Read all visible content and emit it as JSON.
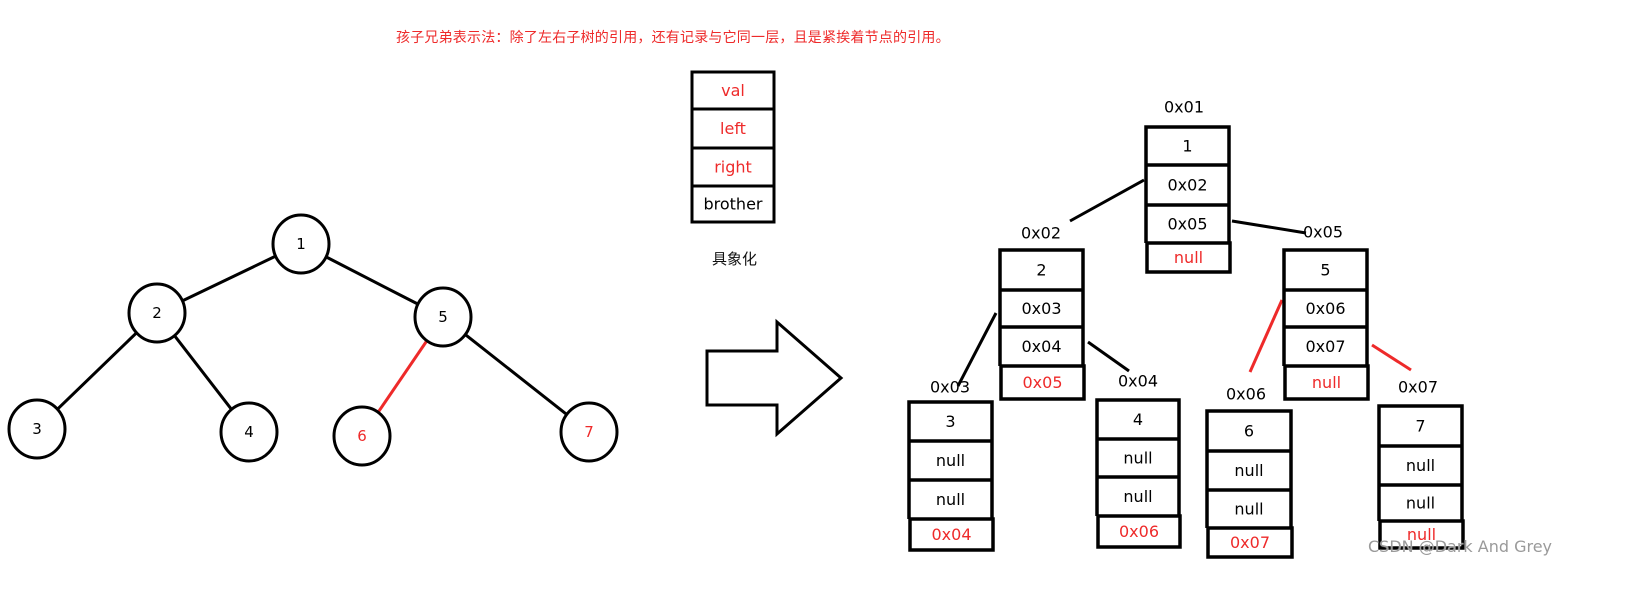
{
  "title": "孩子兄弟表示法：除了左右子树的引用，还有记录与它同一层，且是紧挨着节点的引用。",
  "concretize_label": "具象化",
  "watermark": "CSDN @Dark And Grey",
  "colors": {
    "accent_red": "#ee2a2a",
    "ink": "#000000",
    "watermark": "#9a9a9a"
  },
  "legend_node": {
    "fields": [
      {
        "label": "val",
        "color": "red"
      },
      {
        "label": "left",
        "color": "red"
      },
      {
        "label": "right",
        "color": "red"
      },
      {
        "label": "brother",
        "color": "black"
      }
    ]
  },
  "logical_tree": {
    "nodes": [
      {
        "id": "1",
        "label": "1",
        "color": "black"
      },
      {
        "id": "2",
        "label": "2",
        "color": "black"
      },
      {
        "id": "5",
        "label": "5",
        "color": "black"
      },
      {
        "id": "3",
        "label": "3",
        "color": "black"
      },
      {
        "id": "4",
        "label": "4",
        "color": "black"
      },
      {
        "id": "6",
        "label": "6",
        "color": "red"
      },
      {
        "id": "7",
        "label": "7",
        "color": "red"
      }
    ],
    "edges": [
      {
        "from": "1",
        "to": "2",
        "color": "black"
      },
      {
        "from": "1",
        "to": "5",
        "color": "black"
      },
      {
        "from": "2",
        "to": "3",
        "color": "black"
      },
      {
        "from": "2",
        "to": "4",
        "color": "black"
      },
      {
        "from": "5",
        "to": "6",
        "color": "red"
      },
      {
        "from": "5",
        "to": "7",
        "color": "black"
      }
    ]
  },
  "arrow": {
    "direction": "right",
    "meaning": "transform"
  },
  "memory_nodes": [
    {
      "id": "n1",
      "address": "0x01",
      "val": "1",
      "left": "0x02",
      "right": "0x05",
      "brother": "null"
    },
    {
      "id": "n2",
      "address": "0x02",
      "val": "2",
      "left": "0x03",
      "right": "0x04",
      "brother": "0x05"
    },
    {
      "id": "n5",
      "address": "0x05",
      "val": "5",
      "left": "0x06",
      "right": "0x07",
      "brother": "null"
    },
    {
      "id": "n3",
      "address": "0x03",
      "val": "3",
      "left": "null",
      "right": "null",
      "brother": "0x04"
    },
    {
      "id": "n4",
      "address": "0x04",
      "val": "4",
      "left": "null",
      "right": "null",
      "brother": "0x06"
    },
    {
      "id": "n6",
      "address": "0x06",
      "val": "6",
      "left": "null",
      "right": "null",
      "brother": "0x07"
    },
    {
      "id": "n7",
      "address": "0x07",
      "val": "7",
      "left": "null",
      "right": "null",
      "brother": "null"
    }
  ],
  "memory_links": [
    {
      "from": "n1",
      "field": "left",
      "to": "n2",
      "color": "black"
    },
    {
      "from": "n1",
      "field": "right",
      "to": "n5",
      "color": "black"
    },
    {
      "from": "n2",
      "field": "left",
      "to": "n3",
      "color": "black"
    },
    {
      "from": "n2",
      "field": "right",
      "to": "n4",
      "color": "black"
    },
    {
      "from": "n5",
      "field": "left",
      "to": "n6",
      "color": "red"
    },
    {
      "from": "n5",
      "field": "right",
      "to": "n7",
      "color": "red"
    }
  ]
}
